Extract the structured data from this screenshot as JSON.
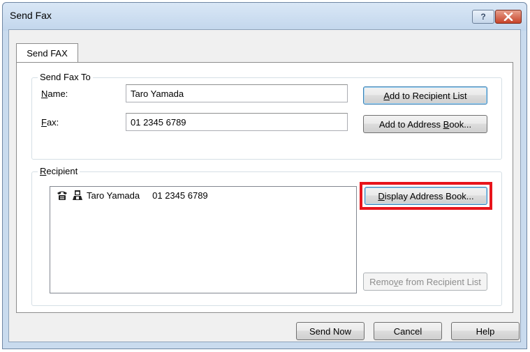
{
  "window": {
    "title": "Send Fax",
    "help_glyph": "?",
    "close_glyph": "✕"
  },
  "tabs": [
    {
      "label": "Send FAX",
      "selected": true
    }
  ],
  "send_fax_to": {
    "group_title": "Send Fax To",
    "name_label_key": "N",
    "name_label_rest": "ame:",
    "name_value": "Taro Yamada",
    "fax_label_key": "F",
    "fax_label_rest": "ax:",
    "fax_value": "01 2345 6789",
    "add_recipient_pre": "",
    "add_recipient_key": "A",
    "add_recipient_post": "dd to Recipient List",
    "add_book_pre": "Add to Address ",
    "add_book_key": "B",
    "add_book_post": "ook..."
  },
  "recipient": {
    "group_title_key": "R",
    "group_title_rest": "ecipient",
    "items": [
      {
        "icons": [
          "fax-icon",
          "person-icon"
        ],
        "name": "Taro Yamada",
        "number": "01 2345 6789"
      }
    ],
    "display_book_key": "D",
    "display_book_post": "isplay Address Book...",
    "remove_pre": "Remo",
    "remove_key": "v",
    "remove_post": "e from Recipient List",
    "remove_enabled": false
  },
  "footer": {
    "send_now": "Send Now",
    "cancel": "Cancel",
    "help": "Help"
  },
  "colors": {
    "highlight": "#e8141b",
    "window_frame": "#c9dbee",
    "close_button": "#c7442a"
  }
}
